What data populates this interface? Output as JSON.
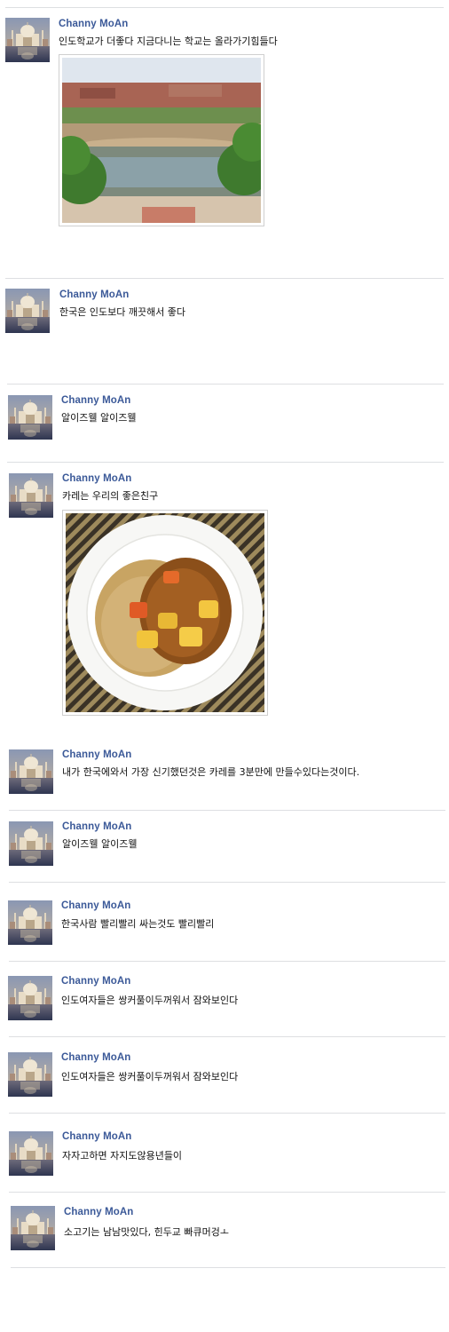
{
  "posts": [
    {
      "author": "Channy MoAn",
      "text": "인도학교가 더좋다 지금다니는 학교는 올라가기힘들다",
      "photo": "campus-courtyard"
    },
    {
      "author": "Channy MoAn",
      "text": "한국은 인도보다 깨끗해서 좋다"
    },
    {
      "author": "Channy MoAn",
      "text": "알이즈웰 알이즈웰"
    },
    {
      "author": "Channy MoAn",
      "text": "카레는 우리의 좋은친구",
      "photo": "curry-rice-plate"
    },
    {
      "author": "Channy MoAn",
      "text": "내가 한국에와서 가장 신기했던것은 카레를 3분만에 만들수있다는것이다."
    },
    {
      "author": "Channy MoAn",
      "text": "알이즈웰 알이즈웰"
    },
    {
      "author": "Channy MoAn",
      "text": "한국사람 빨리빨리 싸는것도 빨리빨리"
    },
    {
      "author": "Channy MoAn",
      "text": "인도여자들은 쌍커풀이두꺼워서 잠와보인다"
    },
    {
      "author": "Channy MoAn",
      "text": "인도여자들은 쌍커풀이두꺼워서 잠와보인다"
    },
    {
      "author": "Channy MoAn",
      "text": "자자고하면 자지도않용년들이"
    },
    {
      "author": "Channy MoAn",
      "text": "소고기는 남남맛있다, 힌두교 빠큐머겅ㅗ"
    }
  ],
  "avatar_icon": "taj-mahal-avatar",
  "colors": {
    "author": "#3b5998",
    "divider": "#dddfe2"
  }
}
